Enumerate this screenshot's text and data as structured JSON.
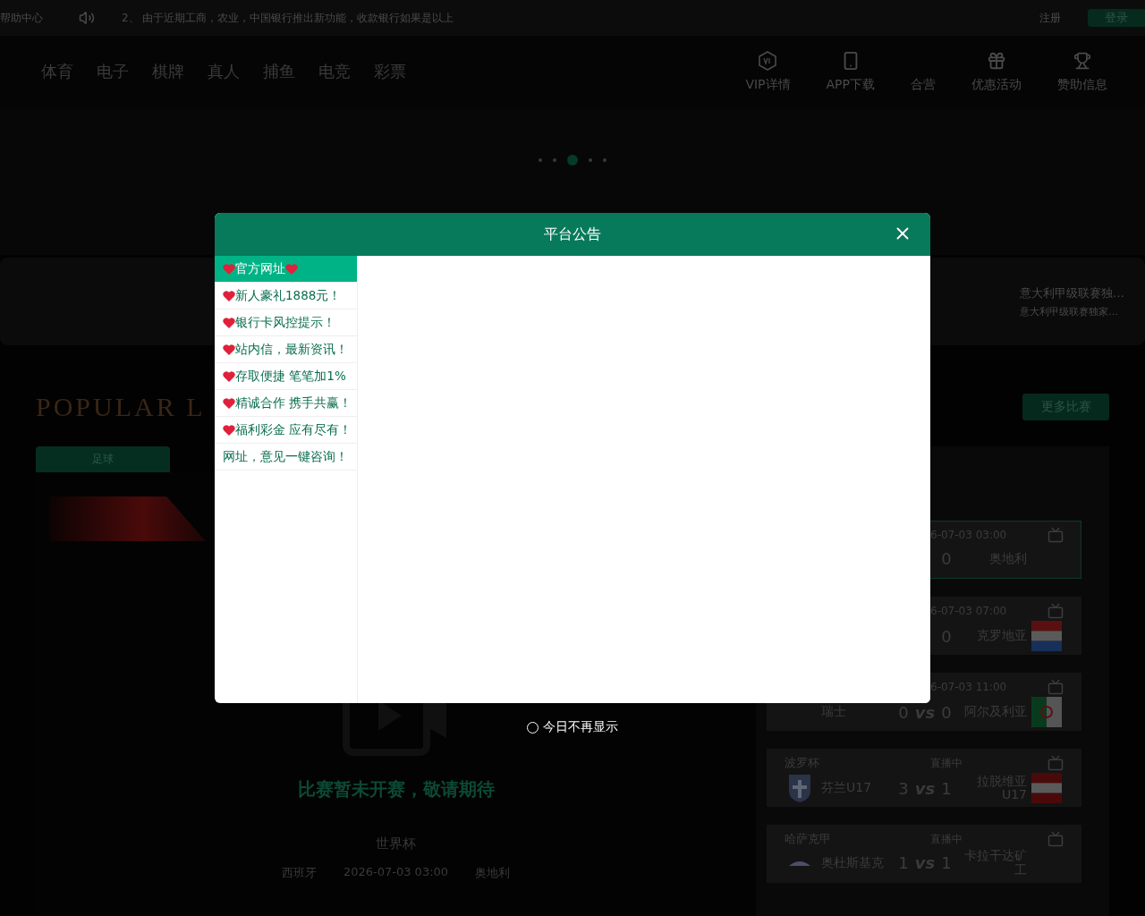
{
  "top_bar": {
    "help": "帮助中心",
    "marquee": "2、 由于近期工商，农业，中国银行推出新功能，收款银行如果是以上",
    "register": "注册",
    "login": "登录"
  },
  "nav": {
    "left": [
      "体育",
      "电子",
      "棋牌",
      "真人",
      "捕鱼",
      "电竞",
      "彩票"
    ],
    "right": [
      "VIP详情",
      "APP下载",
      "合营",
      "优惠活动",
      "赞助信息"
    ]
  },
  "banner": {
    "dots": [
      {
        "selected": false
      },
      {
        "selected": false
      },
      {
        "selected": true
      },
      {
        "selected": false
      },
      {
        "selected": false
      }
    ]
  },
  "notice": {
    "lines": [
      "意大利甲级联赛独…",
      "意大利甲级联赛独家…"
    ]
  },
  "popular": {
    "title": "POPULAR L",
    "more": "更多比赛",
    "tabs": [
      {
        "label": "足球",
        "selected": true
      }
    ]
  },
  "featured": {
    "status": "比赛暂未开赛，敬请期待",
    "league": "世界杯",
    "home": "西班牙",
    "time": "2026-07-03 03:00",
    "away": "奥地利"
  },
  "matches": [
    {
      "selected": true,
      "time": "6-07-03 03:00",
      "score_away": "0",
      "away": "奥地利"
    },
    {
      "selected": false,
      "time": "6-07-03 07:00",
      "score_away": "0",
      "away": "克罗地亚"
    },
    {
      "selected": false,
      "time": "6-07-03 11:00",
      "home": "瑞士",
      "score_home": "0",
      "vs": "vs",
      "score_away": "0",
      "away": "阿尔及利亚"
    },
    {
      "selected": false,
      "league": "波罗杯",
      "time": "直播中",
      "home": "芬兰U17",
      "score_home": "3",
      "vs": "vs",
      "score_away": "1",
      "away": "拉脱维亚U17"
    },
    {
      "selected": false,
      "league": "哈萨克甲",
      "time": "直播中",
      "home": "奥杜斯基克",
      "score_home": "1",
      "vs": "vs",
      "score_away": "1",
      "away": "卡拉干达矿工"
    }
  ],
  "modal": {
    "title": "平台公告",
    "items": [
      {
        "label": "官方网址",
        "heart_before": true,
        "heart_after": true,
        "selected": true
      },
      {
        "label": "新人豪礼1888元！",
        "heart_before": true,
        "heart_after": false,
        "selected": false
      },
      {
        "label": "银行卡风控提示！",
        "heart_before": true,
        "heart_after": false,
        "selected": false
      },
      {
        "label": "站内信，最新资讯！",
        "heart_before": true,
        "heart_after": false,
        "selected": false
      },
      {
        "label": "存取便捷 笔笔加1%",
        "heart_before": true,
        "heart_after": false,
        "selected": false
      },
      {
        "label": "精诚合作 携手共赢！",
        "heart_before": true,
        "heart_after": false,
        "selected": false
      },
      {
        "label": "福利彩金 应有尽有！",
        "heart_before": true,
        "heart_after": false,
        "selected": false
      },
      {
        "label": "网址，意见一键咨询！",
        "heart_before": false,
        "heart_after": false,
        "selected": false
      }
    ],
    "dont_show": {
      "label": "今日不再显示",
      "checked": false
    }
  }
}
